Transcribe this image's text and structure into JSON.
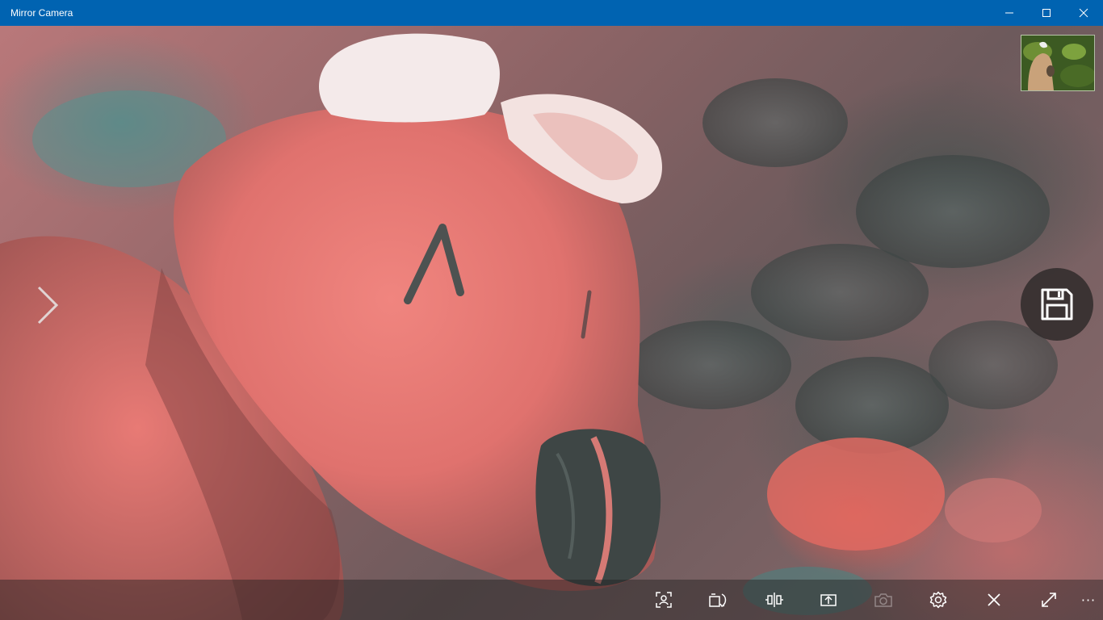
{
  "window": {
    "title": "Mirror Camera",
    "title_bar_color": "#0063b1",
    "caption_buttons": [
      "minimize-icon",
      "maximize-icon",
      "close-icon"
    ]
  },
  "viewport": {
    "preview_subject": "camera-preview",
    "thumbnail": "last-captured-photo-thumbnail",
    "next_arrow_icon": "chevron-right-icon",
    "save_button_icon": "floppy-disk-icon"
  },
  "toolbar": {
    "buttons": [
      {
        "icon": "face-detect-icon",
        "enabled": true
      },
      {
        "icon": "rotate-camera-icon",
        "enabled": true
      },
      {
        "icon": "mirror-flip-icon",
        "enabled": true
      },
      {
        "icon": "share-upload-icon",
        "enabled": true
      },
      {
        "icon": "camera-capture-icon",
        "enabled": false
      },
      {
        "icon": "settings-gear-icon",
        "enabled": true
      },
      {
        "icon": "close-icon",
        "enabled": true
      },
      {
        "icon": "fullscreen-expand-icon",
        "enabled": true
      },
      {
        "icon": "more-ellipsis-icon",
        "enabled": true
      }
    ],
    "more_label": "···"
  }
}
